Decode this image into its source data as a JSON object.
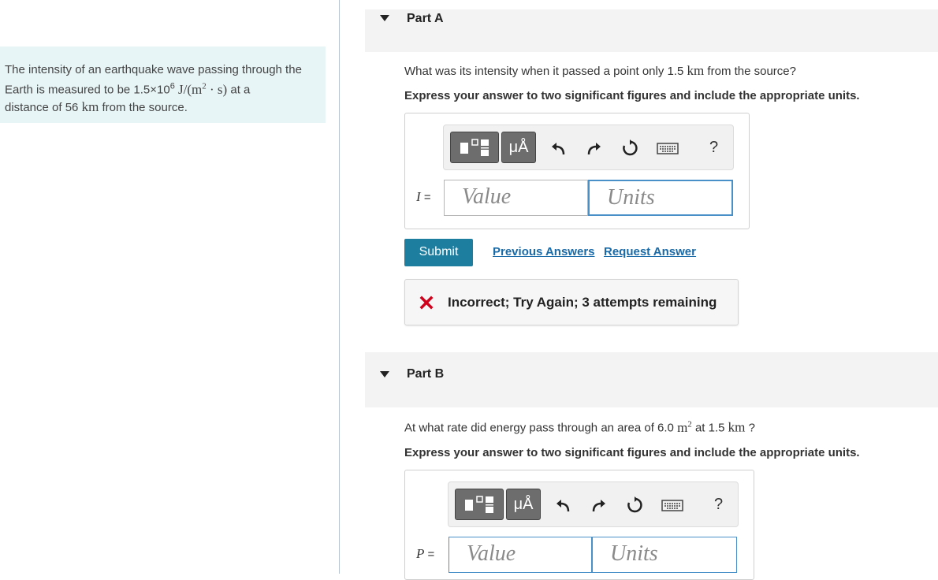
{
  "problem": {
    "intro": "The intensity of an earthquake wave passing through the Earth is measured to be 1.5×10",
    "exp": "6",
    "unit_pre": "J/(m",
    "unit_exp": "2",
    "unit_post": " · s)",
    "at_a": " at a",
    "distance_pre": "distance of 56 ",
    "km": "km",
    "distance_post": " from the source."
  },
  "part_a": {
    "title": "Part A",
    "question_pre": "What was its intensity when it passed a point only 1.5 ",
    "question_km": "km",
    "question_post": " from the source?",
    "instruction": "Express your answer to two significant figures and include the appropriate units.",
    "var": "I",
    "equals": " =",
    "value_placeholder": "Value",
    "units_placeholder": "Units",
    "submit_label": "Submit",
    "previous_answers": "Previous Answers",
    "request_answer": "Request Answer",
    "feedback": "Incorrect; Try Again; 3 attempts remaining"
  },
  "part_b": {
    "title": "Part B",
    "question_pre": "At what rate did energy pass through an area of 6.0 ",
    "question_m": "m",
    "question_exp": "2",
    "question_mid": " at 1.5 ",
    "question_km": "km",
    "question_post": " ?",
    "instruction": "Express your answer to two significant figures and include the appropriate units.",
    "var": "P",
    "equals": " =",
    "value_placeholder": "Value",
    "units_placeholder": "Units"
  },
  "toolbar": {
    "mu_label": "μÅ",
    "help_label": "?"
  },
  "colors": {
    "accent": "#1e7ea0",
    "error": "#d0021b",
    "problem_bg": "#e8f5f6"
  },
  "icons": [
    "templates-icon",
    "units-icon",
    "undo-icon",
    "redo-icon",
    "reset-icon",
    "keyboard-icon",
    "help-icon",
    "incorrect-x-icon",
    "collapse-triangle-icon"
  ]
}
